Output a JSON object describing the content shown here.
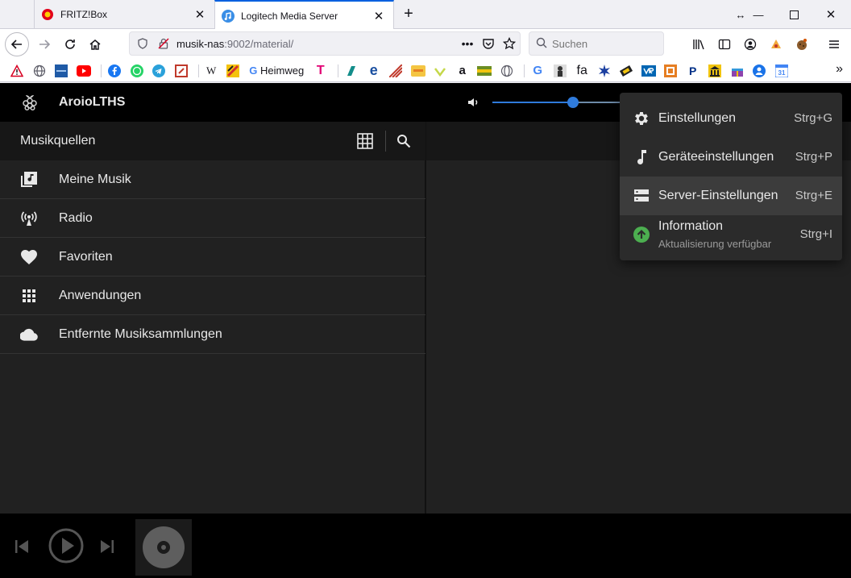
{
  "browser": {
    "tabs": [
      {
        "title": "FRITZ!Box",
        "active": false
      },
      {
        "title": "Logitech Media Server",
        "active": true
      }
    ],
    "url_host": "musik-nas",
    "url_rest": ":9002/material/",
    "search_placeholder": "Suchen",
    "bookmarks": {
      "heimweg_label": "Heimweg",
      "wikipedia_label": "W",
      "g_label": "G",
      "fa_label": "fa"
    }
  },
  "app": {
    "player_name": "AroioLTHS",
    "volume_percent": 0.59,
    "left_header": "Musikquellen",
    "nav_items": [
      {
        "label": "Meine Musik",
        "icon": "library-music-icon"
      },
      {
        "label": "Radio",
        "icon": "radio-tower-icon"
      },
      {
        "label": "Favoriten",
        "icon": "heart-icon"
      },
      {
        "label": "Anwendungen",
        "icon": "apps-grid-icon"
      },
      {
        "label": "Entfernte Musiksammlungen",
        "icon": "cloud-icon"
      }
    ],
    "menu": [
      {
        "label": "Einstellungen",
        "shortcut": "Strg+G",
        "icon": "gear-icon"
      },
      {
        "label": "Geräteeinstellungen",
        "shortcut": "Strg+P",
        "icon": "music-note-icon"
      },
      {
        "label": "Server-Einstellungen",
        "shortcut": "Strg+E",
        "icon": "server-icon"
      },
      {
        "label": "Information",
        "sublabel": "Aktualisierung verfügbar",
        "shortcut": "Strg+I",
        "icon": "update-available-icon"
      }
    ]
  },
  "colors": {
    "accent": "#2f7bdc",
    "update_green": "#4caf50",
    "firefox_tab_accent": "#0060df"
  }
}
